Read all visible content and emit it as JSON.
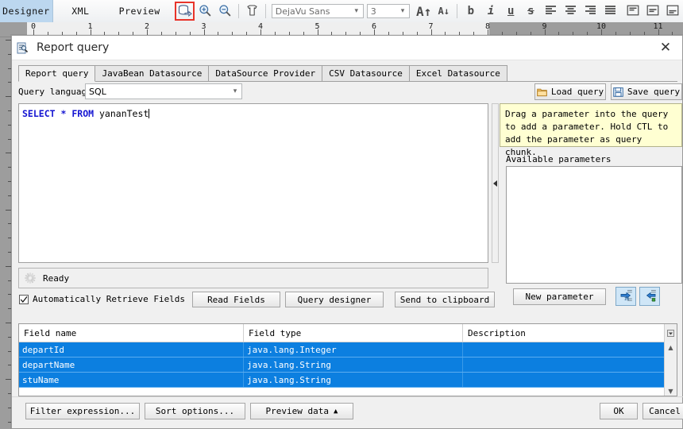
{
  "app": {
    "view_tabs": [
      {
        "label": "Designer",
        "selected": true
      },
      {
        "label": "XML",
        "selected": false
      },
      {
        "label": "Preview",
        "selected": false
      }
    ],
    "toolbar": {
      "datasource_button": "datasource-icon",
      "zoom_in_button": "zoom-in-icon",
      "zoom_out_button": "zoom-out-icon",
      "style_button": "style-icon",
      "font_family": "DejaVu Sans",
      "font_size": "3",
      "grow_font": "A",
      "shrink_font": "A",
      "bold": "b",
      "italic": "i",
      "underline": "u",
      "strikethrough": "s",
      "align_left": "align-left-icon",
      "align_center": "align-center-icon",
      "align_right": "align-right-icon",
      "align_justify": "align-justify-icon",
      "valign_top": "valign-top-icon",
      "valign_middle": "valign-middle-icon",
      "valign_bottom": "valign-bottom-icon"
    },
    "ruler": {
      "marks": [
        "0",
        "1",
        "2",
        "3",
        "4",
        "5",
        "6",
        "7",
        "8",
        "9",
        "10",
        "11"
      ]
    },
    "accent_red": "#e8342a",
    "selection_blue": "#0c7fe0",
    "tab_blue": "#bcd7ef"
  },
  "dialog": {
    "title": "Report query",
    "title_icon": "report-query-icon",
    "close_label": "✕",
    "tabs": [
      {
        "label": "Report query",
        "selected": true
      },
      {
        "label": "JavaBean Datasource",
        "selected": false
      },
      {
        "label": "DataSource Provider",
        "selected": false
      },
      {
        "label": "CSV Datasource",
        "selected": false
      },
      {
        "label": "Excel Datasource",
        "selected": false
      }
    ],
    "query_language_label": "Query language",
    "query_language_value": "SQL",
    "load_query_label": "Load query",
    "save_query_label": "Save query",
    "sql": {
      "keyword1": "SELECT",
      "star": "*",
      "keyword2": "FROM",
      "table": "yananTest"
    },
    "status_text": "Ready",
    "auto_retrieve_label": "Automatically Retrieve Fields",
    "auto_retrieve_checked": true,
    "read_fields_label": "Read Fields",
    "query_designer_label": "Query designer",
    "send_to_clipboard_label": "Send to clipboard",
    "hint_text": "Drag a parameter into the query to add a parameter. Hold CTL to add the parameter as query chunk.",
    "available_parameters_label": "Available parameters",
    "available_parameters": [],
    "new_parameter_label": "New parameter",
    "param_in_button": "parameter-in-icon",
    "param_out_button": "parameter-out-icon",
    "table": {
      "columns": [
        "Field name",
        "Field type",
        "Description"
      ],
      "rows": [
        {
          "name": "departId",
          "type": "java.lang.Integer",
          "description": "",
          "selected": true
        },
        {
          "name": "departName",
          "type": "java.lang.String",
          "description": "",
          "selected": true
        },
        {
          "name": "stuName",
          "type": "java.lang.String",
          "description": "",
          "selected": true
        }
      ]
    },
    "filter_expression_label": "Filter expression...",
    "sort_options_label": "Sort options...",
    "preview_data_label": "Preview data",
    "preview_data_arrow": "▲",
    "ok_label": "OK",
    "cancel_label": "Cancel"
  }
}
